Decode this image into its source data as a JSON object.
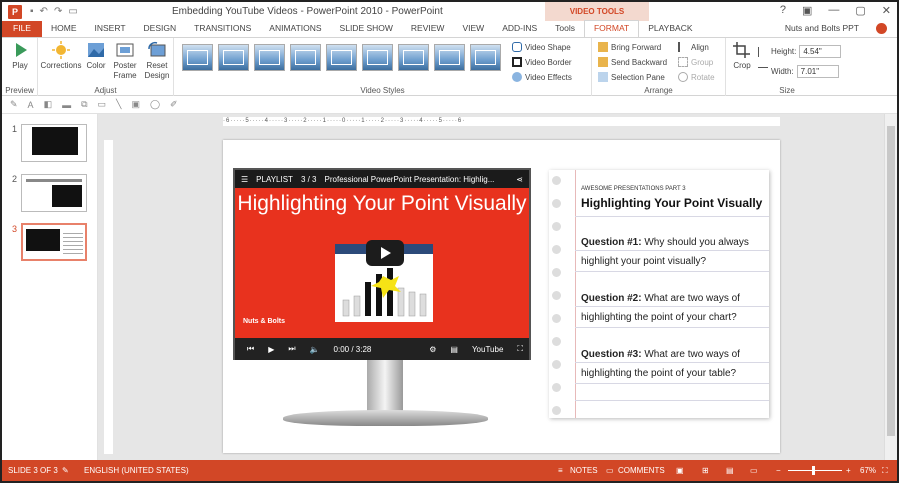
{
  "window": {
    "app_initial": "P",
    "title": "Embedding YouTube Videos - PowerPoint 2010 - PowerPoint",
    "tools_title": "VIDEO TOOLS",
    "user": "Nuts and Bolts PPT",
    "controls": [
      "?",
      "▣",
      "—",
      "▢",
      "✕"
    ]
  },
  "tabs": [
    "FILE",
    "HOME",
    "INSERT",
    "DESIGN",
    "TRANSITIONS",
    "ANIMATIONS",
    "SLIDE SHOW",
    "REVIEW",
    "VIEW",
    "ADD-INS",
    "Tools",
    "FORMAT",
    "PLAYBACK"
  ],
  "ribbon": {
    "preview": {
      "play": "Play",
      "label": "Preview"
    },
    "adjust": {
      "corrections": "Corrections",
      "color": "Color",
      "poster": "Poster Frame",
      "reset": "Reset Design",
      "label": "Adjust"
    },
    "video_styles": {
      "shape": "Video Shape",
      "border": "Video Border",
      "effects": "Video Effects",
      "label": "Video Styles"
    },
    "arrange": {
      "bring_forward": "Bring Forward",
      "send_backward": "Send Backward",
      "selection_pane": "Selection Pane",
      "align": "Align",
      "group": "Group",
      "rotate": "Rotate",
      "label": "Arrange"
    },
    "size": {
      "crop": "Crop",
      "height_label": "Height:",
      "height_value": "4.54\"",
      "width_label": "Width:",
      "width_value": "7.01\"",
      "label": "Size"
    }
  },
  "slide_pane": {
    "numbers": [
      "1",
      "2",
      "3"
    ]
  },
  "ruler": "·6·····5·····4·····3·····2·····1·····0·····1·····2·····3·····4·····5·····6·",
  "video": {
    "playlist": "PLAYLIST",
    "counter": "3 / 3",
    "title": "Professional PowerPoint Presentation: Highlig...",
    "headline": "Highlighting Your Point Visually",
    "brand": "Nuts & Bolts",
    "time": "0:00 / 3:28",
    "yt": "YouTube"
  },
  "note": {
    "kicker": "AWESOME PRESENTATIONS PART 3",
    "heading": "Highlighting Your Point Visually",
    "q1_label": "Question #1:",
    "q1_text": "Why should you always highlight your point visually?",
    "q2_label": "Question #2:",
    "q2_text": "What are two ways of highlighting the point of your chart?",
    "q3_label": "Question #3:",
    "q3_text": "What are two ways of highlighting the point of your table?"
  },
  "status": {
    "slide": "SLIDE 3 OF 3",
    "language": "ENGLISH (UNITED STATES)",
    "notes": "NOTES",
    "comments": "COMMENTS",
    "zoom": "67%"
  }
}
